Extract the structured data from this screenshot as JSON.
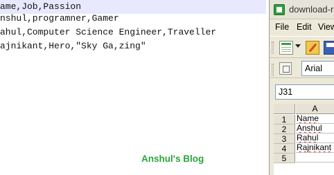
{
  "editor": {
    "lines": [
      "ame,Job,Passion",
      "nshul,programner,Gamer",
      "ahul,Computer Science Engineer,Traveller",
      "ajnikant,Hero,\"Sky Ga,zing\""
    ],
    "watermark": "Anshul's Blog"
  },
  "calc": {
    "title": "download-re",
    "menu": [
      "File",
      "Edit",
      "View"
    ],
    "font_name": "Arial",
    "name_box": "J31",
    "column_header": "A",
    "row_numbers": [
      "1",
      "2",
      "3",
      "4",
      "5"
    ],
    "cells": [
      "Name",
      "Anshul",
      "Rahul",
      "Rajnikant",
      ""
    ]
  },
  "colors": {
    "watermark": "#2aa63a",
    "current_line": "#e8e8ff",
    "spell_underline": "#e03030"
  },
  "icons": [
    "new-document-icon",
    "dropdown-arrow-icon",
    "edit-file-icon",
    "save-icon",
    "styles-icon",
    "app-icon"
  ]
}
